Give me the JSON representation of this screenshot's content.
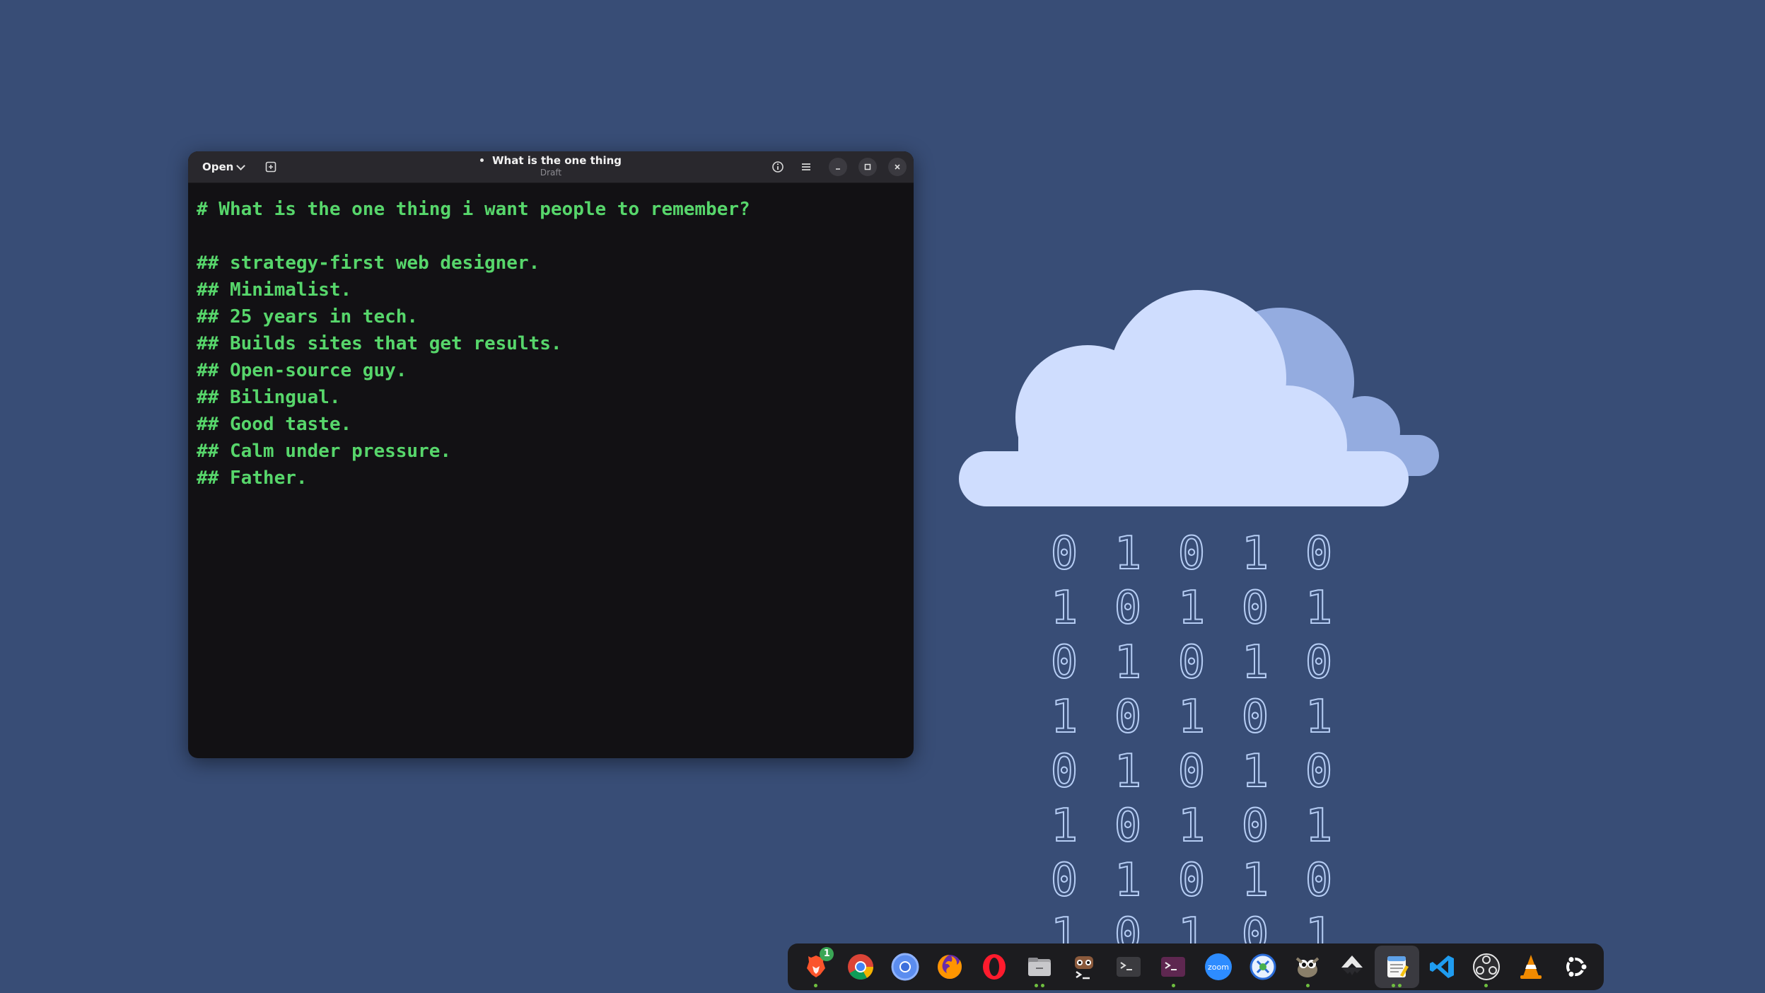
{
  "colors": {
    "desktop": "#384d76",
    "editor_bg": "#121114",
    "editor_text": "#57d66b",
    "titlebar": "#29282d"
  },
  "wallpaper": {
    "binary_rows": [
      [
        "0",
        "1",
        "0",
        "1",
        "0"
      ],
      [
        "1",
        "0",
        "1",
        "0",
        "1"
      ],
      [
        "0",
        "1",
        "0",
        "1",
        "0"
      ],
      [
        "1",
        "0",
        "1",
        "0",
        "1"
      ],
      [
        "0",
        "1",
        "0",
        "1",
        "0"
      ],
      [
        "1",
        "0",
        "1",
        "0",
        "1"
      ],
      [
        "0",
        "1",
        "0",
        "1",
        "0"
      ],
      [
        "1",
        "0",
        "1",
        "0",
        "1"
      ]
    ]
  },
  "window": {
    "open_label": "Open",
    "title": "What is the one thing",
    "subtitle": "Draft",
    "icons": {
      "new_tab": "new-document-icon",
      "info": "info-icon",
      "menu": "hamburger-menu-icon",
      "minimize": "minimize-icon",
      "maximize": "maximize-icon",
      "close": "close-icon"
    }
  },
  "editor": {
    "lines": [
      "# What is the one thing i want people to remember?",
      "",
      "## strategy-first web designer.",
      "## Minimalist.",
      "## 25 years in tech.",
      "## Builds sites that get results.",
      "## Open-source guy.",
      "## Bilingual.",
      "## Good taste.",
      "## Calm under pressure.",
      "## Father."
    ]
  },
  "dock": {
    "items": [
      {
        "name": "brave-browser",
        "icon": "brave-lion-icon",
        "badge": "1",
        "running": 1
      },
      {
        "name": "google-chrome",
        "icon": "chrome-icon",
        "running": 0
      },
      {
        "name": "chromium",
        "icon": "chromium-icon",
        "running": 0
      },
      {
        "name": "firefox",
        "icon": "firefox-icon",
        "running": 0
      },
      {
        "name": "opera",
        "icon": "opera-icon",
        "running": 0
      },
      {
        "name": "files",
        "icon": "folder-icon",
        "running": 2
      },
      {
        "name": "app-terminal",
        "icon": "robot-terminal-icon",
        "running": 0
      },
      {
        "name": "terminal",
        "icon": "terminal-icon",
        "running": 0
      },
      {
        "name": "terminal-alt",
        "icon": "terminal-purple-icon",
        "running": 1
      },
      {
        "name": "zoom",
        "icon": "zoom-icon",
        "label": "zoom",
        "running": 0
      },
      {
        "name": "remote-desktop",
        "icon": "remote-desktop-icon",
        "running": 0
      },
      {
        "name": "gimp",
        "icon": "gimp-icon",
        "running": 1
      },
      {
        "name": "inkscape",
        "icon": "inkscape-icon",
        "running": 0
      },
      {
        "name": "text-editor",
        "icon": "text-editor-icon",
        "running": 2,
        "active": true
      },
      {
        "name": "vscode",
        "icon": "vscode-icon",
        "running": 0
      },
      {
        "name": "obs-studio",
        "icon": "obs-icon",
        "running": 1
      },
      {
        "name": "vlc",
        "icon": "vlc-cone-icon",
        "running": 0
      },
      {
        "name": "ubuntu",
        "icon": "ubuntu-logo-icon",
        "running": 0
      }
    ]
  }
}
